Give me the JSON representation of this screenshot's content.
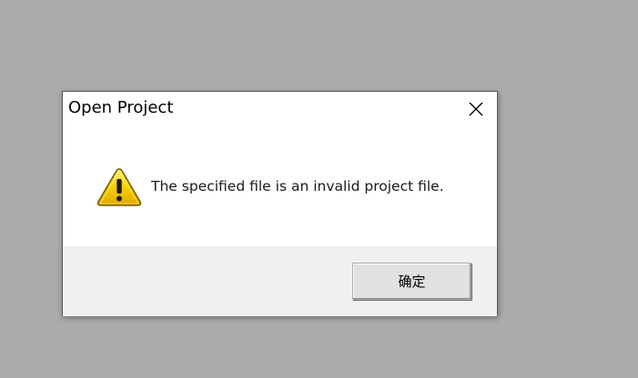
{
  "dialog": {
    "title": "Open Project",
    "message": "The specified file is an invalid project file.",
    "icon": "warning-icon",
    "ok_label": "确定",
    "close_icon": "close-icon"
  },
  "colors": {
    "backdrop": "#ababab",
    "dialog_bg": "#ffffff",
    "footer_bg": "#f0f0f0",
    "warning_fill": "#f5d000",
    "warning_outline": "#8a6a00",
    "button_bg": "#e1e1e1"
  }
}
